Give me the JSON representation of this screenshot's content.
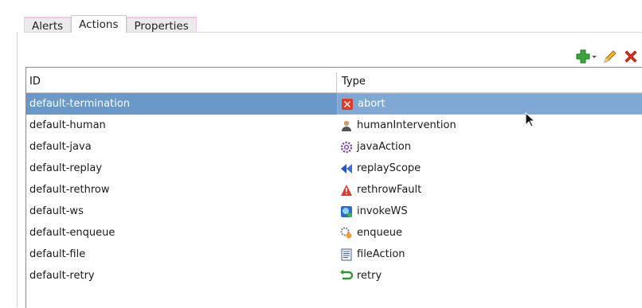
{
  "tabs": [
    {
      "label": "Alerts",
      "active": false
    },
    {
      "label": "Actions",
      "active": true
    },
    {
      "label": "Properties",
      "active": false
    }
  ],
  "toolbar": {
    "add_icon": "plus-dropdown-icon",
    "edit_icon": "pencil-icon",
    "delete_icon": "red-x-icon"
  },
  "table": {
    "columns": [
      "ID",
      "Type"
    ],
    "rows": [
      {
        "id": "default-termination",
        "type": "abort",
        "icon": "abort-icon",
        "selected": true
      },
      {
        "id": "default-human",
        "type": "humanIntervention",
        "icon": "human-icon",
        "selected": false
      },
      {
        "id": "default-java",
        "type": "javaAction",
        "icon": "gear-icon",
        "selected": false
      },
      {
        "id": "default-replay",
        "type": "replayScope",
        "icon": "replay-icon",
        "selected": false
      },
      {
        "id": "default-rethrow",
        "type": "rethrowFault",
        "icon": "warning-icon",
        "selected": false
      },
      {
        "id": "default-ws",
        "type": "invokeWS",
        "icon": "webservice-icon",
        "selected": false
      },
      {
        "id": "default-enqueue",
        "type": "enqueue",
        "icon": "enqueue-icon",
        "selected": false
      },
      {
        "id": "default-file",
        "type": "fileAction",
        "icon": "file-icon",
        "selected": false
      },
      {
        "id": "default-retry",
        "type": "retry",
        "icon": "retry-icon",
        "selected": false
      }
    ]
  },
  "colors": {
    "selection": "#6a98c9",
    "accent_border": "#f0a24d"
  }
}
